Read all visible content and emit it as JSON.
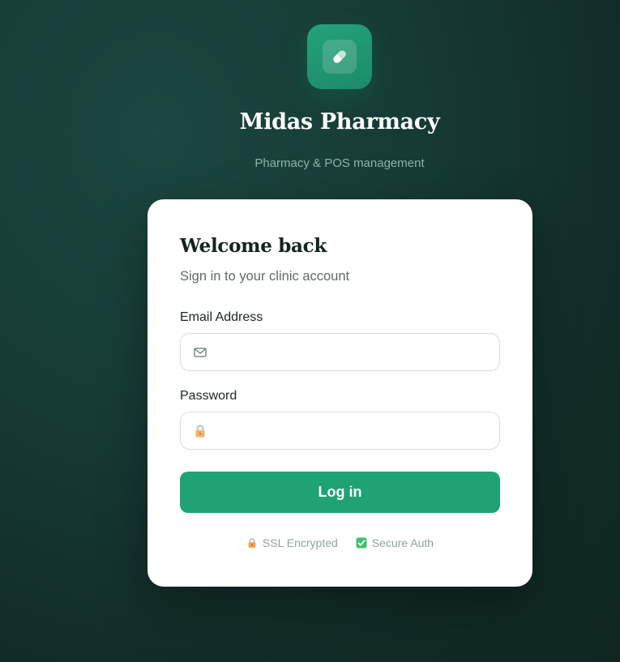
{
  "brand": {
    "title": "Midas Pharmacy",
    "subtitle": "Pharmacy & POS management",
    "logo_icon": "pill-icon",
    "accent_color": "#1fa274"
  },
  "login_card": {
    "heading": "Welcome back",
    "subheading": "Sign in to your clinic account",
    "email": {
      "label": "Email Address",
      "value": "",
      "placeholder": "",
      "icon": "mail-icon"
    },
    "password": {
      "label": "Password",
      "value": "",
      "placeholder": "",
      "icon": "lock-icon"
    },
    "submit_label": "Log in",
    "badges": [
      {
        "icon": "lock-icon",
        "label": "SSL Encrypted"
      },
      {
        "icon": "check-box-icon",
        "label": "Secure Auth"
      }
    ]
  }
}
